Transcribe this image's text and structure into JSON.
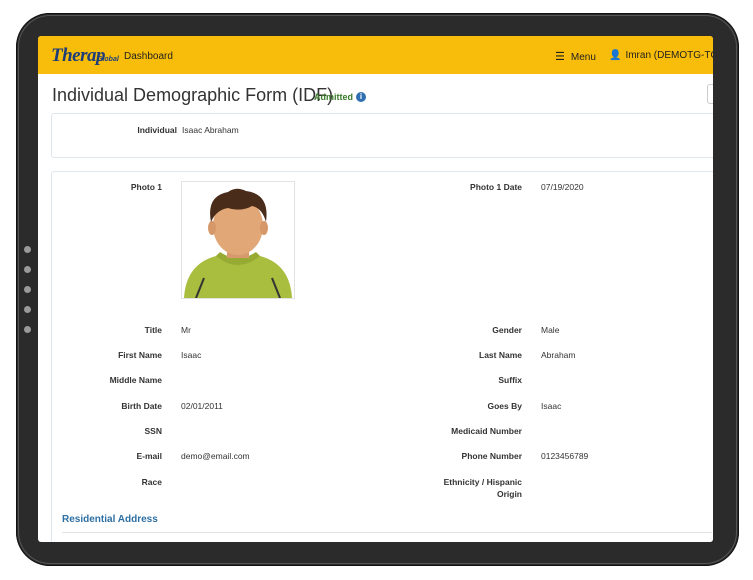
{
  "header": {
    "logo_text": "Therap",
    "logo_sub": "Global",
    "nav_dashboard": "Dashboard",
    "menu_label": "Menu",
    "user_label": "Imran (DEMOTG-TGD)"
  },
  "page": {
    "title": "Individual Demographic Form (IDF)",
    "status": "Admitted"
  },
  "summary": {
    "individual_label": "Individual",
    "individual_value": "Isaac Abraham"
  },
  "details": {
    "photo_label": "Photo 1",
    "photo_date_label": "Photo 1 Date",
    "photo_date_value": "07/19/2020",
    "fields_left": [
      {
        "label": "Title",
        "value": "Mr"
      },
      {
        "label": "First Name",
        "value": "Isaac"
      },
      {
        "label": "Middle Name",
        "value": ""
      },
      {
        "label": "Birth Date",
        "value": "02/01/2011"
      },
      {
        "label": "SSN",
        "value": ""
      },
      {
        "label": "E-mail",
        "value": "demo@email.com"
      },
      {
        "label": "Race",
        "value": ""
      }
    ],
    "fields_right": [
      {
        "label": "Gender",
        "value": "Male"
      },
      {
        "label": "Last Name",
        "value": "Abraham"
      },
      {
        "label": "Suffix",
        "value": ""
      },
      {
        "label": "Goes By",
        "value": "Isaac"
      },
      {
        "label": "Medicaid Number",
        "value": ""
      },
      {
        "label": "Phone Number",
        "value": "0123456789"
      },
      {
        "label": "Ethnicity / Hispanic",
        "value": ""
      }
    ],
    "ethnicity_label_line2": "Origin"
  },
  "residential": {
    "section_title": "Residential Address"
  },
  "colors": {
    "topbar": "#f8bd0b",
    "brand": "#1d3d7a",
    "status": "#3a7a2b",
    "section": "#2d6fa3"
  }
}
